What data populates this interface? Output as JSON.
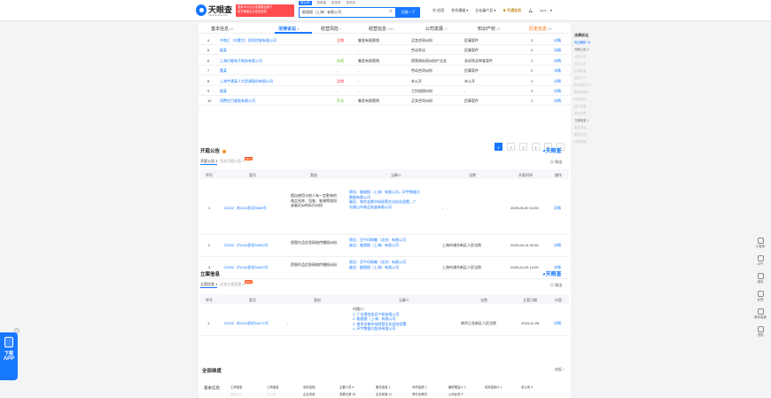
{
  "header": {
    "logo_title": "天眼查",
    "logo_subtitle": "TianYancha.com",
    "ad_lines": [
      "国家中小企业发展基金旗下",
      "官方备案企业征信机构"
    ],
    "search_tabs": [
      "查公司",
      "查老板",
      "查关系",
      "查关系"
    ],
    "search_value": "能搜搜（上海）有限公司",
    "search_button": "天眼一下",
    "nav": [
      "应用",
      "合作通道",
      "企业级产品",
      "开通会员",
      "tyc4..."
    ]
  },
  "section_nav": [
    {
      "label": "基本信息",
      "count": "60"
    },
    {
      "label": "法律诉讼",
      "count": "4"
    },
    {
      "label": "经营风险",
      "count": "1"
    },
    {
      "label": "经营信息",
      "count": "999+"
    },
    {
      "label": "公司发展",
      "count": "37"
    },
    {
      "label": "知识产权",
      "count": "25"
    },
    {
      "label": "历史信息",
      "count": "28"
    }
  ],
  "lawsuit_rows": [
    {
      "no": "4",
      "name": "中商汇（内蒙古）投资控股有限公司",
      "status": "注销",
      "status_color": "red",
      "type": "集里有限营销",
      "cause": "买卖合同纠纷",
      "role": "民事案件",
      "count": "2",
      "action": "详情"
    },
    {
      "no": "5",
      "name": "殷某",
      "status": "-",
      "type": "-",
      "cause": "劳动争议",
      "role": "民事案件",
      "count": "2",
      "action": "详情"
    },
    {
      "no": "6",
      "name": "上海亿能电子商务有限公司",
      "status": "存续",
      "status_color": "green",
      "type": "集里有限营销",
      "cause": "侵害商标权纠纷产业金",
      "role": "非诉保全审查案件",
      "count": "2",
      "action": "详情"
    },
    {
      "no": "7",
      "name": "董某",
      "status": "-",
      "type": "-",
      "cause": "劳动合同纠纷",
      "role": "民事案件",
      "count": "2",
      "action": "详情"
    },
    {
      "no": "8",
      "name": "上海宇通某人力资源股份有限公司",
      "status": "注销",
      "status_color": "red",
      "type": "-",
      "cause": "未公开",
      "role": "未公开",
      "count": "2",
      "action": "详情"
    },
    {
      "no": "9",
      "name": "殷某",
      "status": "-",
      "type": "-",
      "cause": "工伤赔偿纠纷",
      "role": "-",
      "count": "2",
      "action": "详情"
    },
    {
      "no": "10",
      "name": "消费在日查股有限公司",
      "status": "开业",
      "status_color": "green",
      "type": "集里有限营销",
      "cause": "买卖合同纠纷",
      "role": "民事案件",
      "count": "1",
      "action": "详情"
    }
  ],
  "pager": [
    "1",
    "2",
    "3",
    "4",
    "5",
    "›"
  ],
  "court_notice": {
    "title": "开庭公告",
    "watermark": "天眼查",
    "tab_active": "开庭公告 3",
    "tab_other": "历史开庭公告 0",
    "new_badge": "NEW",
    "export": "导出",
    "headers": [
      "序号",
      "案号",
      "案由",
      "当事人",
      "法院",
      "开庭时间",
      "操作"
    ],
    "rows": [
      {
        "no": "1",
        "case": "（2025）苏0162民初3386号",
        "cause": [
          "擅自使用与他人有一定影响的",
          "商品名称、包装、装潢等相同",
          "或者近似的标识纠纷"
        ],
        "parties": [
          "原告：能搜搜（上海）有限公司，环宇数据大",
          "数据有限公司",
          "被告：南京金都市场经营文化创业园置，广",
          "东佛山市商品发展有限公司"
        ],
        "court": "-",
        "time": "2025-05-30 14:30",
        "action": "详情"
      },
      {
        "no": "2",
        "case": "（2025）沪0115民初54920号",
        "cause": [
          "侵害作品信息网络传播权纠纷"
        ],
        "parties": [
          "原告：豆牛印刷集（北京）有限公司",
          "被告：能搜搜（上海）有限公司"
        ],
        "court": "上海市浦东新区人民法院",
        "time": "2025-05-14 09:30",
        "action": "详情"
      },
      {
        "no": "3",
        "case": "（2025）沪0115民初54920号",
        "cause": [
          "侵害作品信息网络传播权纠纷"
        ],
        "parties": [
          "原告：豆牛印刷集（北京）有限公司",
          "被告：能搜搜（上海）有限公司"
        ],
        "court": "上海市浦东新区人民法院",
        "time": "2025-04-25 14:00",
        "action": "详情"
      }
    ]
  },
  "filing": {
    "title": "立案信息",
    "watermark": "天眼查",
    "tab_active": "立案信息 1",
    "tab_other": "历史立案信息 0",
    "new_badge": "NEW",
    "export": "导出",
    "headers": [
      "序号",
      "案号",
      "案由",
      "当事人",
      "法院",
      "立案日期",
      "内容"
    ],
    "row": {
      "no": "1",
      "case": "（2024）苏0162民初18471号",
      "cause": "-",
      "parties_title": "代理人：",
      "parties": [
        "1. 广东德信知识产权有限公司",
        "2. 能搜搜（上海）有限公司",
        "3. 南京金都市场经营文化创业园置",
        "4. 环宇数据大股份有限公司"
      ],
      "court": "南京江北新区人民法院",
      "date": "2024-11-28",
      "action": "详情"
    }
  },
  "all_dimensions": {
    "title": "全部维度",
    "collapse": "收起 ^",
    "basic_label": "基本信息",
    "items_row1": [
      "工商信息",
      "工商信息",
      "实际控制",
      "主要人员 4",
      "股东信息 1",
      "对外投资 2",
      "最终受益人 1",
      "实际控制人 1",
      "总公司 2"
    ],
    "items_row2": [
      "最新公示",
      "分公司",
      "企业关系",
      "变更记录 23",
      "企业年报 11",
      "同行业情况",
      "公司业务 9",
      "",
      ""
    ]
  },
  "right_sidebar": {
    "title": "法律诉讼",
    "items": [
      {
        "label": "司法解析",
        "count": "16",
        "state": "active"
      },
      {
        "label": "开庭公告",
        "count": "3",
        "state": "dark"
      },
      {
        "label": "法院公告",
        "count": "",
        "state": "gray"
      },
      {
        "label": "送达公告",
        "count": "",
        "state": "gray"
      },
      {
        "label": "立案信息",
        "count": "",
        "state": "gray"
      },
      {
        "label": "被执行人",
        "count": "",
        "state": "gray"
      },
      {
        "label": "失信被执行人",
        "count": "",
        "state": "gray"
      },
      {
        "label": "限制消费令",
        "count": "",
        "state": "gray"
      },
      {
        "label": "终本案件",
        "count": "",
        "state": "gray"
      },
      {
        "label": "破产重整",
        "count": "",
        "state": "gray"
      },
      {
        "label": "司法协助",
        "count": "",
        "state": "gray"
      },
      {
        "label": "立案信息",
        "count": "1",
        "state": "dark"
      },
      {
        "label": "股权冻结",
        "count": "",
        "state": "gray"
      },
      {
        "label": "限制出境",
        "count": "",
        "state": "gray"
      },
      {
        "label": "诉前调解",
        "count": "",
        "state": "gray"
      }
    ]
  },
  "float_bar": [
    "小程序",
    "APP",
    "报告",
    "反馈",
    "联系客服",
    "顶部"
  ],
  "left_ad": {
    "line1": "下载",
    "line2": "APP",
    "close": "×"
  },
  "colors": {
    "primary": "#1677ff",
    "danger": "#f5222d",
    "success": "#52c41a",
    "warning": "#fa8c16"
  }
}
